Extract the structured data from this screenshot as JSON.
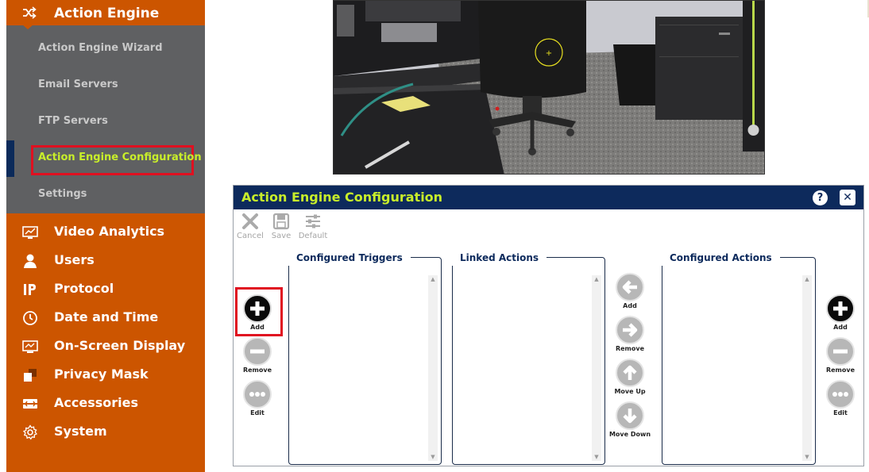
{
  "sidebar": {
    "header": {
      "label": "Action Engine",
      "icon": "shuffle-icon"
    },
    "subitems": [
      {
        "label": "Action Engine Wizard"
      },
      {
        "label": "Email Servers"
      },
      {
        "label": "FTP Servers"
      },
      {
        "label": "Action Engine Configuration",
        "active": true
      },
      {
        "label": "Settings"
      }
    ],
    "items": [
      {
        "label": "Video Analytics",
        "icon": "analytics-icon"
      },
      {
        "label": "Users",
        "icon": "user-icon"
      },
      {
        "label": "Protocol",
        "icon": "ip-icon"
      },
      {
        "label": "Date and Time",
        "icon": "clock-icon"
      },
      {
        "label": "On-Screen Display",
        "icon": "monitor-icon"
      },
      {
        "label": "Privacy Mask",
        "icon": "mask-icon"
      },
      {
        "label": "Accessories",
        "icon": "accessories-icon"
      },
      {
        "label": "System",
        "icon": "gear-icon"
      }
    ],
    "colors": {
      "background": "#cc5500",
      "submenu": "#5f6062",
      "active_text": "#c8ee2a",
      "highlight_box": "#e01020"
    }
  },
  "camera": {
    "description_icon": "camera-feed"
  },
  "dialog": {
    "title": "Action Engine Configuration",
    "help_glyph": "?",
    "close_glyph": "✕",
    "toolbar": {
      "cancel_label": "Cancel",
      "save_label": "Save",
      "default_label": "Default"
    },
    "panels": {
      "triggers_title": "Configured Triggers",
      "linked_title": "Linked Actions",
      "actions_title": "Configured Actions"
    },
    "left_buttons": {
      "add": "Add",
      "remove": "Remove",
      "edit": "Edit"
    },
    "middle_buttons": {
      "add": "Add",
      "remove": "Remove",
      "move_up": "Move Up",
      "move_down": "Move Down"
    },
    "right_buttons": {
      "add": "Add",
      "remove": "Remove",
      "edit": "Edit"
    },
    "colors": {
      "title_bg": "#0d2a5c",
      "title_text": "#c8ee2a"
    }
  }
}
